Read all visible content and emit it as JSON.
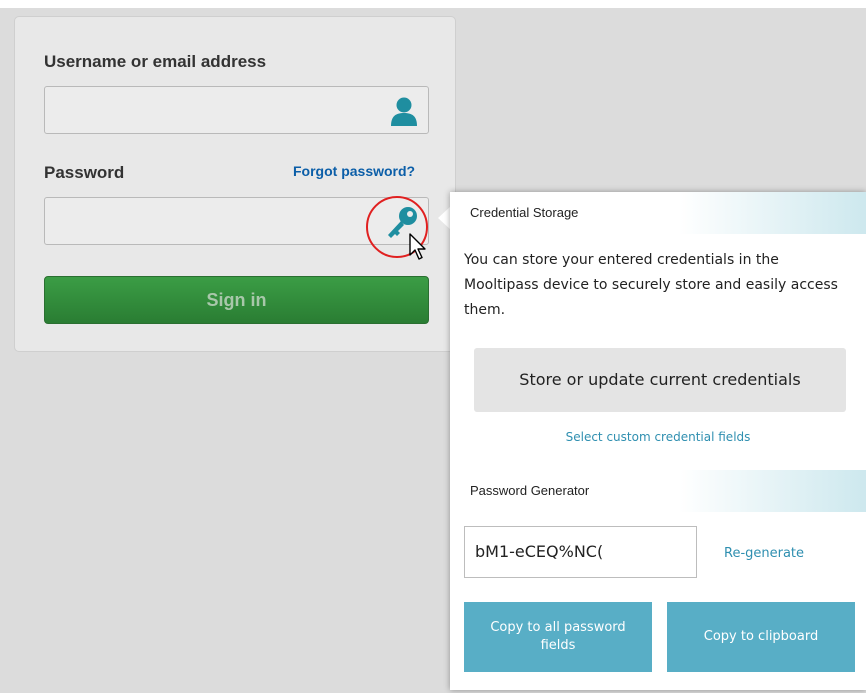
{
  "login": {
    "username_label": "Username or email address",
    "username_value": "",
    "password_label": "Password",
    "password_value": "",
    "forgot_link": "Forgot password?",
    "signin_label": "Sign in"
  },
  "popup": {
    "storage_header": "Credential Storage",
    "storage_text": "You can store your entered credentials in the Mooltipass device to securely store and easily access them.",
    "store_button": "Store or update current credentials",
    "custom_fields_link": "Select custom credential fields",
    "generator_header": "Password Generator",
    "generated_password": "bM1-eCEQ%NC(",
    "regenerate_link": "Re-generate",
    "copy_all_button": "Copy to all password fields",
    "copy_clipboard_button": "Copy to clipboard"
  },
  "colors": {
    "signin_green": "#2f8a3a",
    "icon_teal": "#1f8ea0",
    "accent_blue": "#58aec6",
    "highlight_red": "#e02020"
  },
  "icons": {
    "username_field": "user-icon",
    "password_field": "key-icon",
    "cursor": "mouse-pointer-icon"
  }
}
